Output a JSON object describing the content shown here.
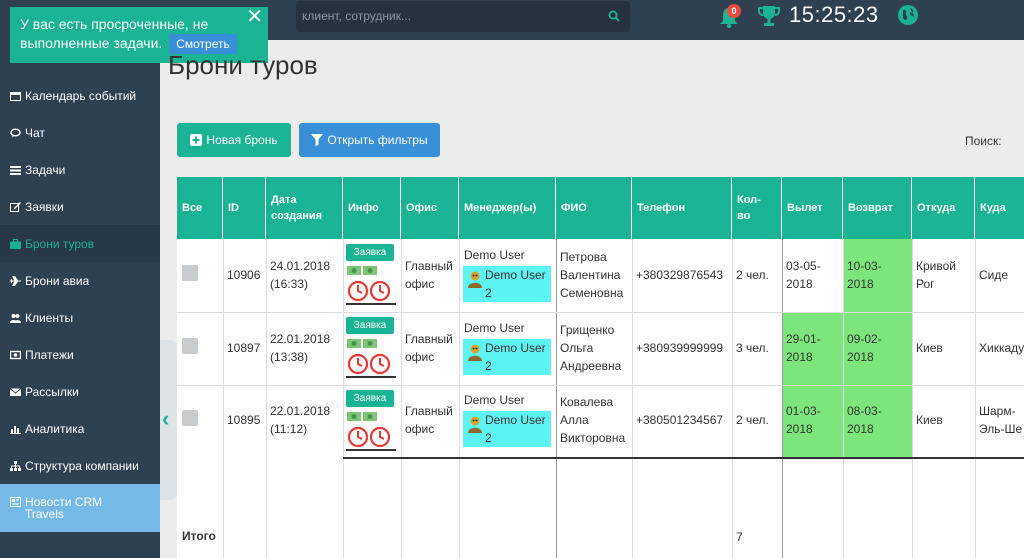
{
  "topbar": {
    "search_placeholder": "клиент, сотрудник...",
    "bell_count": "0",
    "clock": "15:25:23"
  },
  "notification": {
    "text": "У вас есть просроченные, не выполненные задачи.",
    "button": "Смотреть"
  },
  "sidebar": {
    "items": [
      {
        "label": "Календарь событий",
        "icon": "calendar-icon"
      },
      {
        "label": "Чат",
        "icon": "chat-icon"
      },
      {
        "label": "Задачи",
        "icon": "tasks-icon"
      },
      {
        "label": "Заявки",
        "icon": "edit-icon"
      },
      {
        "label": "Брони туров",
        "icon": "suitcase-icon"
      },
      {
        "label": "Брони авиа",
        "icon": "plane-icon"
      },
      {
        "label": "Клиенты",
        "icon": "users-icon"
      },
      {
        "label": "Платежи",
        "icon": "money-icon"
      },
      {
        "label": "Рассылки",
        "icon": "envelope-icon"
      },
      {
        "label": "Аналитика",
        "icon": "bar-chart-icon"
      },
      {
        "label": "Структура компании",
        "icon": "sitemap-icon"
      },
      {
        "label": "Новости CRM Travels",
        "icon": "newspaper-icon"
      }
    ]
  },
  "page": {
    "title": "Брони туров",
    "new_booking": "Новая бронь",
    "open_filters": "Открыть фильтры",
    "search_label": "Поиск:"
  },
  "table": {
    "headers": [
      "Все",
      "ID",
      "Дата создания",
      "Инфо",
      "Офис",
      "Менеджер(ы)",
      "ФИО",
      "Телефон",
      "Кол-во",
      "Вылет",
      "Возврат",
      "Откуда",
      "Куда"
    ],
    "badge": "Заявка",
    "rows": [
      {
        "id": "10906",
        "created": "24.01.2018 (16:33)",
        "office": "Главный офис",
        "manager": "Demo User",
        "manager2": "Demo User 2",
        "fio": "Петрова Валентина Семеновна",
        "phone": "+380329876543",
        "count": "2 чел.",
        "depart": "03-05-2018",
        "return": "10-03-2018",
        "from": "Кривой Рог",
        "to": "Сиде"
      },
      {
        "id": "10897",
        "created": "22.01.2018 (13:38)",
        "office": "Главный офис",
        "manager": "Demo User",
        "manager2": "Demo User 2",
        "fio": "Грищенко Ольга Андреевна",
        "phone": "+380939999999",
        "count": "3 чел.",
        "depart": "29-01-2018",
        "return": "09-02-2018",
        "from": "Киев",
        "to": "Хиккаду"
      },
      {
        "id": "10895",
        "created": "22.01.2018 (11:12)",
        "office": "Главный офис",
        "manager": "Demo User",
        "manager2": "Demo User 2",
        "fio": "Ковалева Алла Викторовна",
        "phone": "+380501234567",
        "count": "2 чел.",
        "depart": "01-03-2018",
        "return": "08-03-2018",
        "from": "Киев",
        "to": "Шарм-Эль-Ше"
      }
    ],
    "total_label": "Итого",
    "total_count": "7"
  }
}
